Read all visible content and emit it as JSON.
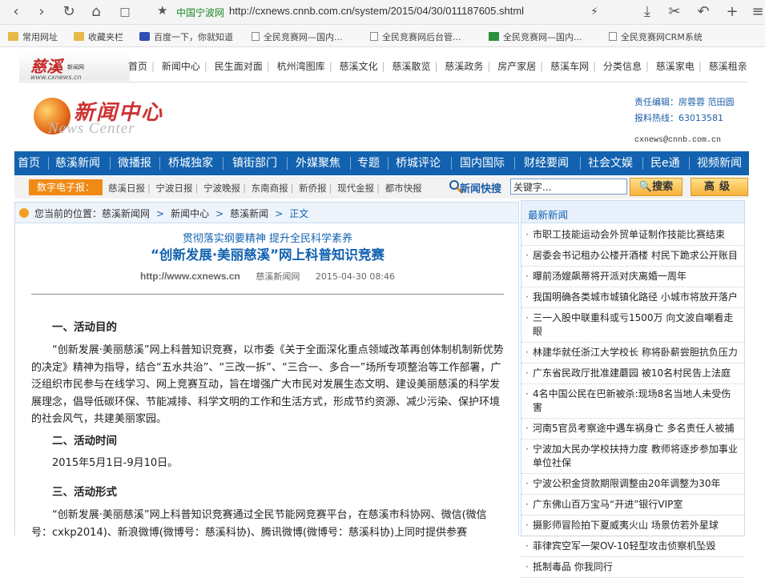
{
  "browser": {
    "site_label": "中国宁波网",
    "url": "http://cxnews.cnnb.com.cn/system/2015/04/30/011187605.shtml"
  },
  "bookmarks": [
    {
      "label": "常用网址",
      "icon": "folder-icon"
    },
    {
      "label": "收藏夹栏",
      "icon": "folder-icon"
    },
    {
      "label": "百度一下，你就知道",
      "icon": "baidu-paw-icon"
    },
    {
      "label": "全民竞赛网—国内...",
      "icon": "page-icon"
    },
    {
      "label": "全民竞赛网后台管...",
      "icon": "page-icon"
    },
    {
      "label": "全民竞赛网—国内...",
      "icon": "site-icon"
    },
    {
      "label": "全民竞赛网CRM系统",
      "icon": "page-icon"
    }
  ],
  "site": {
    "logo_text": "慈溪",
    "logo_sub": "新闻网",
    "logo_url": "www.cxnews.cn",
    "top_nav": [
      "首页",
      "新闻中心",
      "民生面对面",
      "杭州湾图库",
      "慈溪文化",
      "慈溪散览",
      "慈溪政务",
      "房产家居",
      "慈溪车网",
      "分类信息",
      "慈溪家电",
      "慈溪租亲"
    ]
  },
  "header": {
    "logo_cn": "新闻中心",
    "logo_en": "News Center",
    "editor_label": "责任编辑：",
    "editor_names": "房蓉蓉  范田圆",
    "hotline_label": "报料热线：",
    "hotline": "63013581",
    "email": "cxnews@cnnb.com.cn"
  },
  "main_nav": [
    "首页",
    "慈溪新闻",
    "微播报",
    "桥城独家",
    "镇街部门",
    "外媒聚焦",
    "专题",
    "桥城评论",
    "国内国际",
    "财经要闻",
    "社会文娱",
    "民e通",
    "视频新闻"
  ],
  "epaper": {
    "label": "数字电子报：",
    "papers": [
      "慈溪日报",
      "宁波日报",
      "宁波晚报",
      "东南商报",
      "新侨报",
      "现代金报",
      "都市快报"
    ],
    "quick_search_label": "新闻快搜",
    "search_value": "关键字...",
    "search_button": "搜索",
    "advanced_button": "高级"
  },
  "breadcrumb": {
    "prefix": "您当前的位置：",
    "items": [
      "慈溪新闻网",
      "新闻中心",
      "慈溪新闻"
    ],
    "current": "正文"
  },
  "article": {
    "subtitle": "贯彻落实纲要精神  提升全民科学素养",
    "title": "“创新发展·美丽慈溪”网上科普知识竞赛",
    "source_url": "http://www.cxnews.cn",
    "source_name": "慈溪新闻网",
    "date": "2015-04-30 08:46",
    "sections": [
      {
        "heading": "一、活动目的",
        "text": "“创新发展·美丽慈溪”网上科普知识竞赛，以市委《关于全面深化重点领域改革再创体制机制新优势的决定》精神为指导，结合“五水共治”、“三改一拆”、“三合一、多合一”场所专项整治等工作部署，广泛组织市民参与在线学习、网上竞赛互动，旨在增强广大市民对发展生态文明、建设美丽慈溪的科学发展理念，倡导低碳环保、节能减排、科学文明的工作和生活方式，形成节约资源、减少污染、保护环境的社会风气，共建美丽家园。"
      },
      {
        "heading": "二、活动时间",
        "text": "2015年5月1日-9月10日。"
      },
      {
        "heading": "三、活动形式",
        "text": "“创新发展·美丽慈溪”网上科普知识竞赛通过全民节能网竞赛平台，在慈溪市科协网、微信(微信号：cxkp2014)、新浪微博(微博号：慈溪科协)、腾讯微博(微博号：慈溪科协)上同时提供参赛"
      }
    ]
  },
  "sidebar": {
    "title": "最新新闻",
    "items": [
      "市职工技能运动会外贸单证制作技能比赛结束",
      "居委会书记租办公楼开酒楼 村民下跪求公开账目",
      "曝前汤嫂飙蒂将开派对庆离婚一周年",
      "我国明确各类城市城镇化路径 小城市将放开落户",
      "三一入股中联重科或亏1500万 向文波自嘲看走眼",
      "林建华就任浙江大学校长 称将卧薪尝胆抗负压力",
      "广东省民政厅批准建蘑园 被10名村民告上法庭",
      "4名中国公民在巴新被杀:现场8名当地人未受伤害",
      "河南5官员考察途中遇车祸身亡 多名责任人被捕",
      "宁波加大民办学校扶持力度 教师将逐步参加事业单位社保",
      "宁波公积金贷款期限调整由20年调整为30年",
      "广东佛山百万宝马“开进”银行VIP室",
      "摄影师冒险拍下夏威夷火山 场景仿若外星球",
      "菲律宾空军一架OV-10轻型攻击侦察机坠毁",
      "抵制毒品 你我同行"
    ]
  }
}
